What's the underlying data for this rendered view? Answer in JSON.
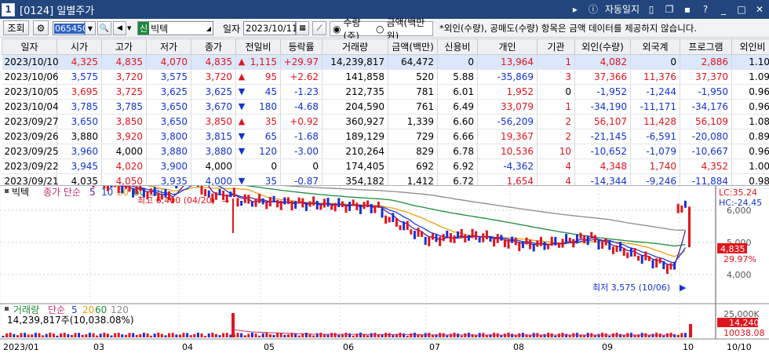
{
  "window": {
    "number": "1",
    "title": "[0124] 일별주가",
    "right_label": "자동일지"
  },
  "toolbar": {
    "search_label": "조회",
    "code": "065450",
    "market_badge": "신",
    "stock_name": "빅텍",
    "date_label": "일자",
    "date_value": "2023/10/11",
    "radio_volume": "수량(주)",
    "radio_amount": "금액(백만원)",
    "note": "*외인(수량), 공매도(수량) 항목은 금액 데이터를 제공하지 않습니다."
  },
  "table": {
    "headers": [
      "일자",
      "시가",
      "고가",
      "저가",
      "종가",
      "전일비",
      "등락률",
      "거래량",
      "금액(백만)",
      "신용비",
      "개인",
      "기관",
      "외인(수량)",
      "외국계",
      "프로그램",
      "외인비"
    ],
    "rows": [
      {
        "date": "2023/10/10",
        "open": "4,325",
        "high": "4,835",
        "low": "4,070",
        "close": "4,835",
        "dir": "up",
        "chg": "1,115",
        "rate": "+29.97",
        "vol": "14,239,817",
        "amt": "64,472",
        "credit": "0",
        "indiv": "13,964",
        "inst": "1",
        "foreign": "4,082",
        "fgn_firm": "0",
        "prog": "2,886",
        "fratio": "1.10"
      },
      {
        "date": "2023/10/06",
        "open": "3,575",
        "high": "3,720",
        "low": "3,575",
        "close": "3,720",
        "dir": "up",
        "chg": "95",
        "rate": "+2.62",
        "vol": "141,858",
        "amt": "520",
        "credit": "5.88",
        "indiv": "-35,869",
        "inst": "3",
        "foreign": "37,366",
        "fgn_firm": "11,376",
        "prog": "37,370",
        "fratio": "1.09"
      },
      {
        "date": "2023/10/05",
        "open": "3,695",
        "high": "3,725",
        "low": "3,625",
        "close": "3,625",
        "dir": "down",
        "chg": "45",
        "rate": "-1.23",
        "vol": "212,735",
        "amt": "781",
        "credit": "6.01",
        "indiv": "1,952",
        "inst": "0",
        "foreign": "-1,952",
        "fgn_firm": "-1,244",
        "prog": "-1,950",
        "fratio": "0.96"
      },
      {
        "date": "2023/10/04",
        "open": "3,785",
        "high": "3,785",
        "low": "3,650",
        "close": "3,670",
        "dir": "down",
        "chg": "180",
        "rate": "-4.68",
        "vol": "204,590",
        "amt": "761",
        "credit": "6.49",
        "indiv": "33,079",
        "inst": "1",
        "foreign": "-34,190",
        "fgn_firm": "-11,171",
        "prog": "-34,176",
        "fratio": "0.96"
      },
      {
        "date": "2023/09/27",
        "open": "3,650",
        "high": "3,850",
        "low": "3,650",
        "close": "3,850",
        "dir": "up",
        "chg": "35",
        "rate": "+0.92",
        "vol": "360,927",
        "amt": "1,339",
        "credit": "6.60",
        "indiv": "-56,209",
        "inst": "2",
        "foreign": "56,107",
        "fgn_firm": "11,428",
        "prog": "56,109",
        "fratio": "1.08"
      },
      {
        "date": "2023/09/26",
        "open": "3,880",
        "high": "3,920",
        "low": "3,800",
        "close": "3,815",
        "dir": "down",
        "chg": "65",
        "rate": "-1.68",
        "vol": "189,129",
        "amt": "729",
        "credit": "6.66",
        "indiv": "19,367",
        "inst": "2",
        "foreign": "-21,145",
        "fgn_firm": "-6,591",
        "prog": "-20,080",
        "fratio": "0.89"
      },
      {
        "date": "2023/09/25",
        "open": "3,960",
        "high": "4,000",
        "low": "3,880",
        "close": "3,880",
        "dir": "down",
        "chg": "120",
        "rate": "-3.00",
        "vol": "210,264",
        "amt": "829",
        "credit": "6.78",
        "indiv": "10,536",
        "inst": "10",
        "foreign": "-10,652",
        "fgn_firm": "-1,079",
        "prog": "-10,667",
        "fratio": "0.96"
      },
      {
        "date": "2023/09/22",
        "open": "3,945",
        "high": "4,020",
        "low": "3,900",
        "close": "4,000",
        "dir": "none",
        "chg": "0",
        "rate": "0",
        "vol": "174,405",
        "amt": "692",
        "credit": "6.92",
        "indiv": "-4,362",
        "inst": "4",
        "foreign": "4,348",
        "fgn_firm": "1,740",
        "prog": "4,352",
        "fratio": "1.00"
      },
      {
        "date": "2023/09/21",
        "open": "4,035",
        "high": "4,050",
        "low": "3,935",
        "close": "4,000",
        "dir": "down",
        "chg": "35",
        "rate": "-0.87",
        "vol": "354,182",
        "amt": "1,412",
        "credit": "6.72",
        "indiv": "1,654",
        "inst": "4",
        "foreign": "-14,344",
        "fgn_firm": "-9,246",
        "prog": "-11,884",
        "fratio": "0.98"
      }
    ]
  },
  "chart": {
    "price_legend": {
      "name": "빅텍",
      "ma_label": "종가 단순",
      "ma1": "5",
      "ma2": "10",
      "ma3": "20",
      "ma4": "60",
      "ma5": "120"
    },
    "high_note": "최고 6,400 (04/20)",
    "low_note": "최저 3,575 (10/06)",
    "lc": "LC:35.24",
    "hc": "HC:-24.45",
    "price_axis": [
      "6,000",
      "5,000",
      "4,000"
    ],
    "last_price": "4,835",
    "last_rate": "29.97%",
    "vol_legend": {
      "name": "거래량",
      "ma_label": "단순",
      "ma1": "5",
      "ma2": "20",
      "ma3": "60",
      "ma4": "120"
    },
    "vol_value": "14,239,817주(10,038.08%)",
    "vol_axis": "25,000K",
    "last_vol": "14,240K",
    "last_vol_pct": "10038.08",
    "x_labels": [
      "2023/01",
      "03",
      "04",
      "05",
      "06",
      "07",
      "08",
      "09",
      "10"
    ],
    "x_right": "10/10",
    "colors": {
      "up": "#e2141c",
      "down": "#1232d4",
      "ma5": "#5a1a9a",
      "ma10": "#1f3fd0",
      "ma20": "#e8a010",
      "ma60": "#1a8a3a",
      "ma120": "#8a8a8a",
      "title_bg": "#21457c"
    }
  }
}
